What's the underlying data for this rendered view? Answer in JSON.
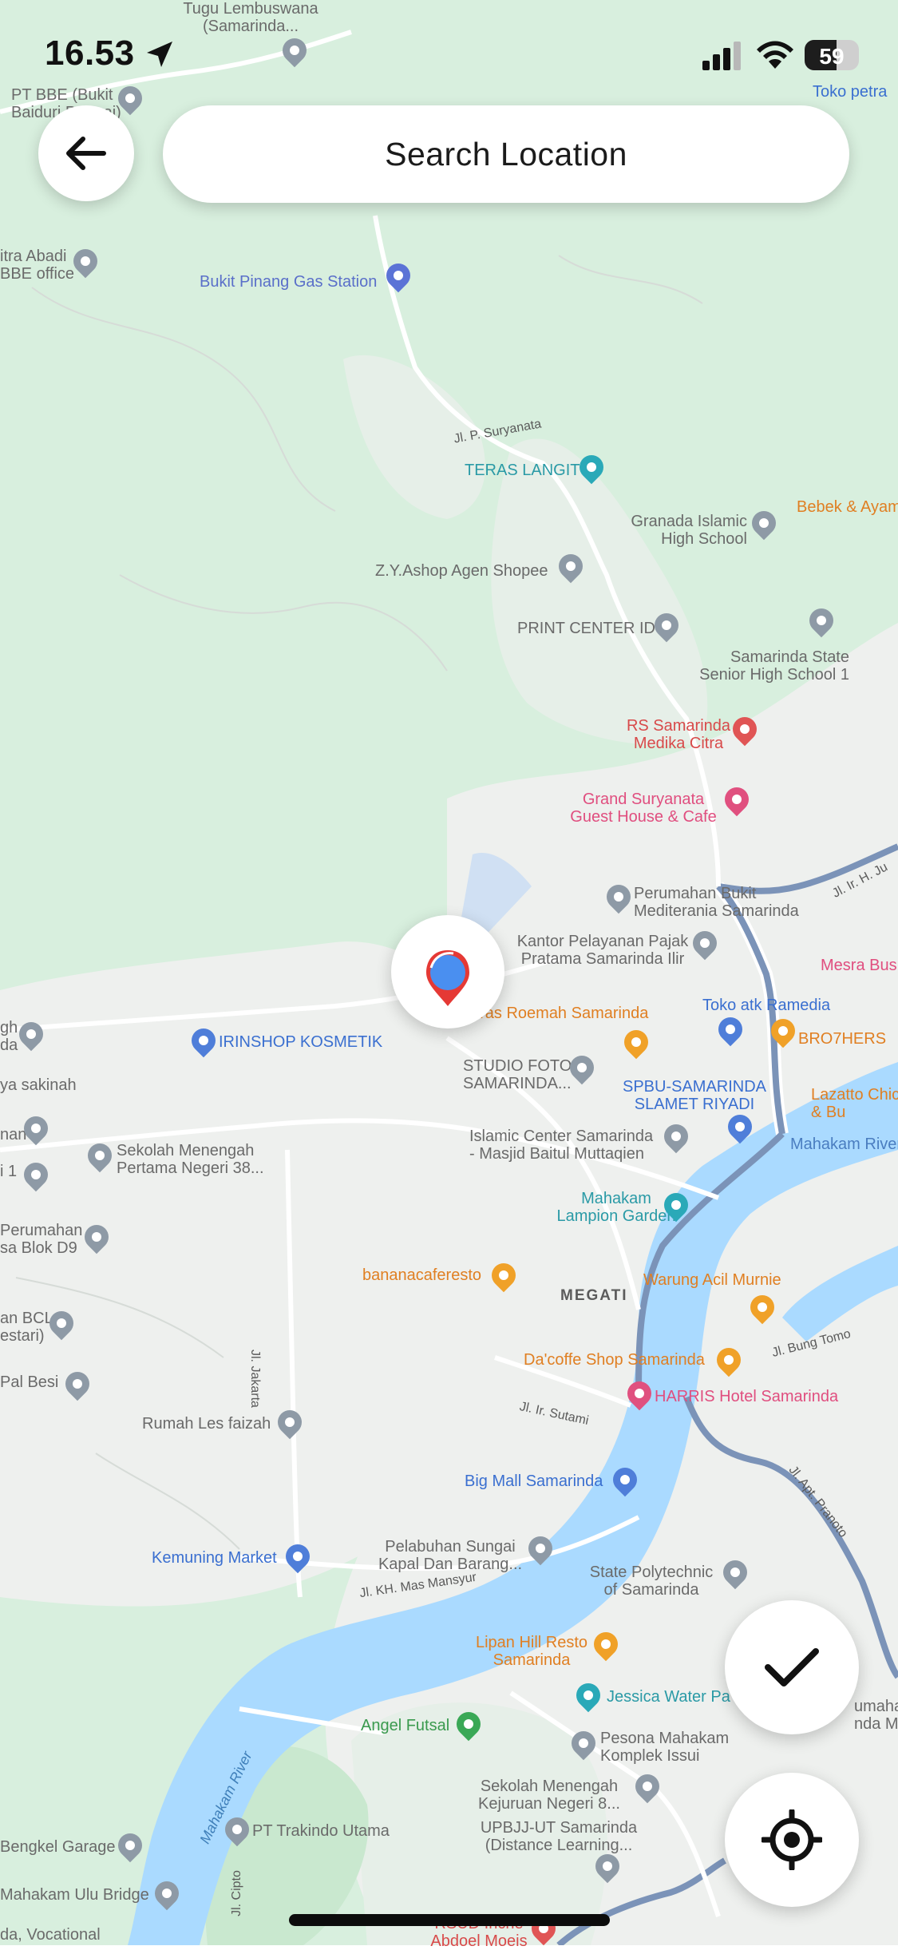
{
  "status_bar": {
    "time": "16.53",
    "battery_level": "59",
    "battery_fraction": 0.59
  },
  "header": {
    "search_label": "Search Location"
  },
  "map": {
    "district_label": "MEGATI",
    "water_color": "#aadaff",
    "land_color": "#d8efde",
    "urban_color": "#eef0ee",
    "road_color": "#ffffff",
    "major_road_color": "#7b93b8",
    "roads": [
      {
        "id": "road-jl-p-suryanata",
        "label": "Jl. P. Suryanata"
      },
      {
        "id": "road-jl-jakarta",
        "label": "Jl. Jakarta"
      },
      {
        "id": "road-jl-ir-sutami",
        "label": "Jl. Ir. Sutami"
      },
      {
        "id": "road-jl-kh-mas-mansyur",
        "label": "Jl. KH. Mas Mansyur"
      },
      {
        "id": "road-jl-bung-tomo",
        "label": "Jl. Bung Tomo"
      },
      {
        "id": "road-jl-apt-pranoto",
        "label": "Jl. Apt. Pranoto"
      },
      {
        "id": "road-jl-ir-h-juanda",
        "label": "Jl. Ir. H. Ju"
      },
      {
        "id": "road-jl-cipto",
        "label": "Jl. Cipto"
      }
    ],
    "river_label": "Mahakam River",
    "river_label_right": "Mahakam River",
    "places": [
      {
        "id": "tugu-lembuswana",
        "label": "Tugu Lembuswana\n(Samarinda...",
        "kind": "gray"
      },
      {
        "id": "pt-bbe",
        "label": "PT BBE (Bukit\nBaiduri Permai)",
        "kind": "gray"
      },
      {
        "id": "toko-petra",
        "label": "Toko petra",
        "kind": "blue"
      },
      {
        "id": "citra-abadi",
        "label": "itra Abadi\nBBE office",
        "kind": "gray"
      },
      {
        "id": "bukit-pinang-gas",
        "label": "Bukit Pinang Gas Station",
        "kind": "blue"
      },
      {
        "id": "teras-langit",
        "label": "TERAS LANGIT",
        "kind": "teal"
      },
      {
        "id": "bebek-ayam",
        "label": "Bebek & Ayam",
        "kind": "orange"
      },
      {
        "id": "granada-islamic",
        "label": "Granada Islamic\nHigh School",
        "kind": "gray"
      },
      {
        "id": "zy-ashop",
        "label": "Z.Y.Ashop Agen Shopee",
        "kind": "gray"
      },
      {
        "id": "print-center",
        "label": "PRINT CENTER ID",
        "kind": "gray"
      },
      {
        "id": "sman-1",
        "label": "Samarinda State\nSenior High School 1",
        "kind": "gray"
      },
      {
        "id": "rs-medika",
        "label": "RS Samarinda\nMedika Citra",
        "kind": "red"
      },
      {
        "id": "grand-suryanata",
        "label": "Grand Suryanata\nGuest House & Cafe",
        "kind": "pink"
      },
      {
        "id": "perumahan-bukit",
        "label": "Perumahan Bukit\nMediterania Samarinda",
        "kind": "gray"
      },
      {
        "id": "kantor-pajak",
        "label": "Kantor Pelayanan Pajak\nPratama Samarinda Ilir",
        "kind": "gray"
      },
      {
        "id": "mesra-bus",
        "label": "Mesra Bus",
        "kind": "pink"
      },
      {
        "id": "teras-roemah",
        "label": "Teras Roemah Samarinda",
        "kind": "orange"
      },
      {
        "id": "toko-atk",
        "label": "Toko atk Ramedia",
        "kind": "blue"
      },
      {
        "id": "brothers",
        "label": "BRO7HERS",
        "kind": "orange"
      },
      {
        "id": "irinshop",
        "label": "IRINSHOP KOSMETIK",
        "kind": "blue"
      },
      {
        "id": "studio-foto",
        "label": "STUDIO FOTO\nSAMARINDA...",
        "kind": "gray"
      },
      {
        "id": "spbu",
        "label": "SPBU-SAMARINDA\nSLAMET RIYADI",
        "kind": "blue"
      },
      {
        "id": "lazatto",
        "label": "Lazatto Chic\n& Bu",
        "kind": "orange"
      },
      {
        "id": "gh-left",
        "label": "gh\nda",
        "kind": "gray"
      },
      {
        "id": "ya-sakinah",
        "label": "ya sakinah",
        "kind": "gray"
      },
      {
        "id": "smp-38",
        "label": "Sekolah Menengah\nPertama Negeri 38...",
        "kind": "gray"
      },
      {
        "id": "islamic-center",
        "label": "Islamic Center Samarinda\n- Masjid Baitul Muttaqien",
        "kind": "gray"
      },
      {
        "id": "mahakam-river-right",
        "label": "Mahakam River",
        "kind": "blue-text"
      },
      {
        "id": "nan-left",
        "label": "nan",
        "kind": "gray"
      },
      {
        "id": "i-left",
        "label": "i 1",
        "kind": "gray"
      },
      {
        "id": "mahakam-lampion",
        "label": "Mahakam\nLampion Garden",
        "kind": "teal"
      },
      {
        "id": "perumahan-blok-d9",
        "label": "Perumahan\nsa Blok D9",
        "kind": "gray"
      },
      {
        "id": "bananacaferesto",
        "label": "bananacaferesto",
        "kind": "orange"
      },
      {
        "id": "warung-acil",
        "label": "Warung Acil Murnie",
        "kind": "orange"
      },
      {
        "id": "bcl",
        "label": "an BCL\nestari)",
        "kind": "gray"
      },
      {
        "id": "dacoffe",
        "label": "Da'coffe Shop Samarinda",
        "kind": "orange"
      },
      {
        "id": "pal-besi",
        "label": "Pal Besi",
        "kind": "gray"
      },
      {
        "id": "harris-hotel",
        "label": "HARRIS Hotel Samarinda",
        "kind": "pink"
      },
      {
        "id": "rumah-les",
        "label": "Rumah Les faizah",
        "kind": "gray"
      },
      {
        "id": "big-mall",
        "label": "Big Mall Samarinda",
        "kind": "blue"
      },
      {
        "id": "pelabuhan",
        "label": "Pelabuhan Sungai\nKapal Dan Barang...",
        "kind": "gray"
      },
      {
        "id": "kemuning",
        "label": "Kemuning Market",
        "kind": "blue"
      },
      {
        "id": "polytechnic",
        "label": "State Polytechnic\nof Samarinda",
        "kind": "gray"
      },
      {
        "id": "lipan-hill",
        "label": "Lipan Hill Resto\nSamarinda",
        "kind": "orange"
      },
      {
        "id": "jessica-water",
        "label": "Jessica Water Pa",
        "kind": "teal"
      },
      {
        "id": "umah-mulia",
        "label": "umahan\nnda Mulia",
        "kind": "gray"
      },
      {
        "id": "angel-futsal",
        "label": "Angel Futsal",
        "kind": "green"
      },
      {
        "id": "pesona-mahakam",
        "label": "Pesona Mahakam\nKomplek Issui",
        "kind": "gray"
      },
      {
        "id": "smk-8",
        "label": "Sekolah Menengah\nKejuruan Negeri 8...",
        "kind": "gray"
      },
      {
        "id": "pt-trakindo",
        "label": "PT Trakindo Utama",
        "kind": "gray"
      },
      {
        "id": "upbjj",
        "label": "UPBJJ-UT Samarinda\n(Distance Learning...",
        "kind": "gray"
      },
      {
        "id": "bengkel-garage",
        "label": "Bengkel Garage",
        "kind": "gray"
      },
      {
        "id": "mahakam-ulu-bridge",
        "label": "Mahakam Ulu Bridge",
        "kind": "gray"
      },
      {
        "id": "rsud",
        "label": "RSUD Inche\nAbdoel Moeis",
        "kind": "red"
      },
      {
        "id": "vocational",
        "label": "da, Vocational",
        "kind": "gray"
      }
    ]
  }
}
